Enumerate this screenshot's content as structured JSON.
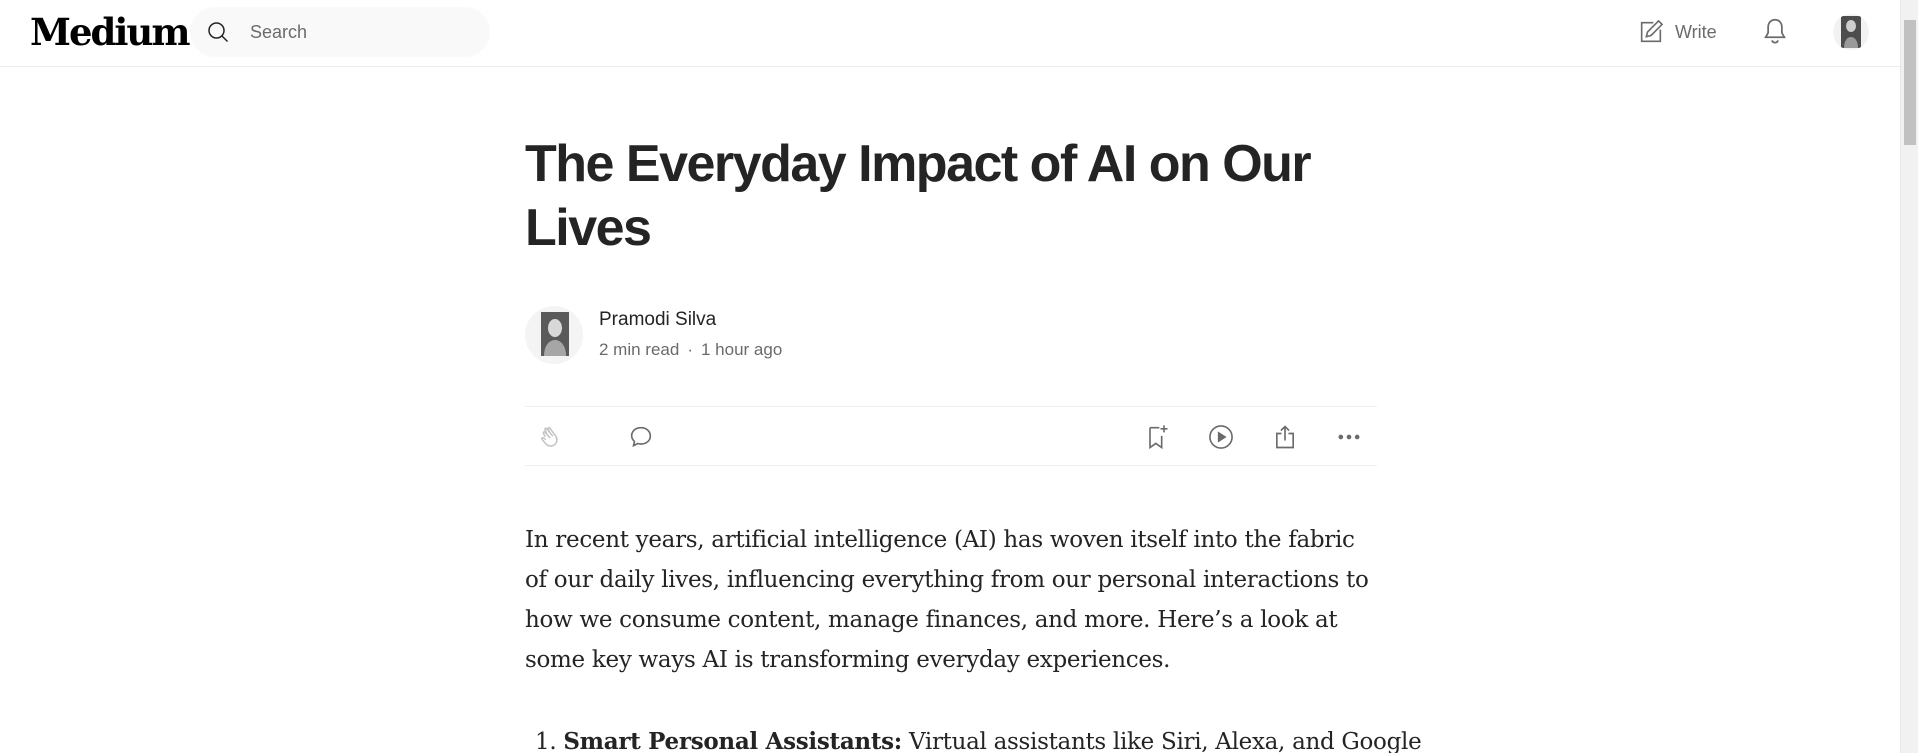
{
  "header": {
    "logo": "Medium",
    "search_placeholder": "Search",
    "write_label": "Write"
  },
  "article": {
    "title": "The Everyday Impact of AI on Our Lives",
    "author": "Pramodi Silva",
    "read_time": "2 min read",
    "separator": "·",
    "published": "1 hour ago",
    "intro": "In recent years, artificial intelligence (AI) has woven itself into the fabric of our daily lives, influencing everything from our personal interactions to how we consume content, manage finances, and more. Here’s a look at some key ways AI is transforming everyday experiences.",
    "list": [
      {
        "number": "1.",
        "heading": "Smart Personal Assistants:",
        "text": "Virtual assistants like Siri, Alexa, and Google"
      }
    ]
  },
  "actions": [
    "clap-icon",
    "comment-icon",
    "bookmark-icon",
    "listen-icon",
    "share-icon",
    "more-icon"
  ],
  "colors": {
    "text": "#242424",
    "muted": "#6b6b6b",
    "search_bg": "#f9f9f9"
  }
}
